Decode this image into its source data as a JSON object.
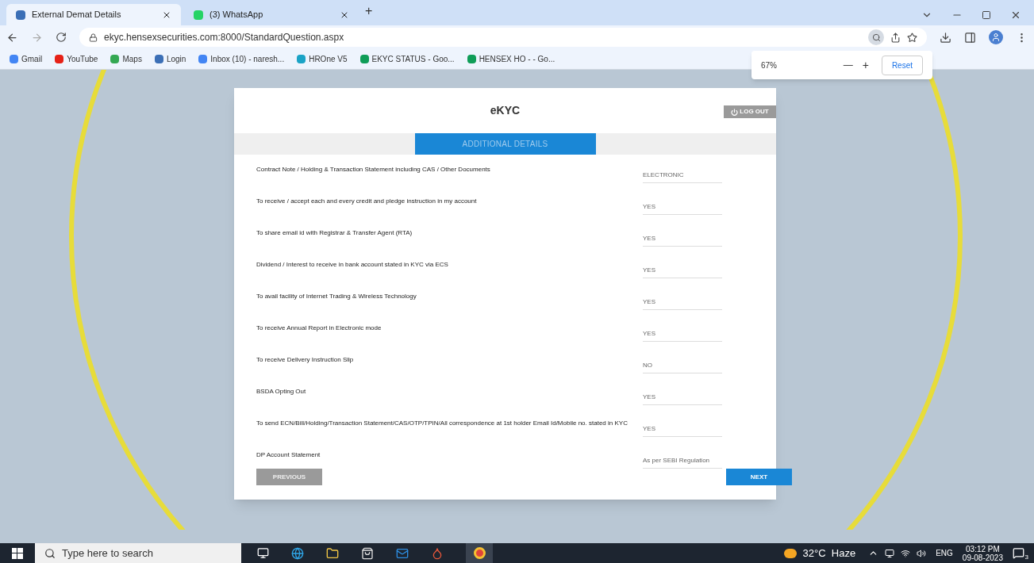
{
  "browser": {
    "tabs": [
      {
        "title": "External Demat Details",
        "selected": true
      },
      {
        "title": "(3) WhatsApp",
        "selected": false
      }
    ],
    "new_tab": "+",
    "url": "ekyc.hensexsecurities.com:8000/StandardQuestion.aspx",
    "bookmarks": [
      "Gmail",
      "YouTube",
      "Maps",
      "Login",
      "Inbox (10) - naresh...",
      "HROne V5",
      "EKYC STATUS - Goo...",
      "HENSEX HO - - Go..."
    ],
    "zoom_popup": {
      "level": "67%",
      "minus": "—",
      "plus": "+",
      "reset": "Reset"
    }
  },
  "dialog": {
    "title": "eKYC",
    "logout": "LOG OUT",
    "section_tab": "ADDITIONAL DETAILS",
    "questions": [
      {
        "label": "Contract Note / Holding & Transaction Statement including CAS / Other Documents",
        "value": "ELECTRONIC"
      },
      {
        "label": "To receive / accept each and every credit and pledge instruction in my account",
        "value": "YES"
      },
      {
        "label": "To share email id with Registrar & Transfer Agent (RTA)",
        "value": "YES"
      },
      {
        "label": "Dividend / Interest to receive in bank account stated in KYC via ECS",
        "value": "YES"
      },
      {
        "label": "To avail facility of Internet Trading & Wireless Technology",
        "value": "YES"
      },
      {
        "label": "To receive Annual Report in Electronic mode",
        "value": "YES"
      },
      {
        "label": "To receive Delivery Instruction Slip",
        "value": "NO"
      },
      {
        "label": "BSDA Opting Out",
        "value": "YES"
      },
      {
        "label": "To send ECN/Bill/Holding/Transaction Statement/CAS/OTP/TPIN/All correspondence at 1st holder Email Id/Mobile no. stated in KYC",
        "value": "YES"
      },
      {
        "label": "DP Account Statement",
        "value": "As per SEBI Regulation"
      }
    ],
    "previous": "PREVIOUS",
    "next": "NEXT"
  },
  "taskbar": {
    "search_placeholder": "Type here to search",
    "weather": "32°C  Haze",
    "language": "ENG",
    "time": "03:12 PM",
    "date": "09-08-2023",
    "notifications": "3"
  }
}
